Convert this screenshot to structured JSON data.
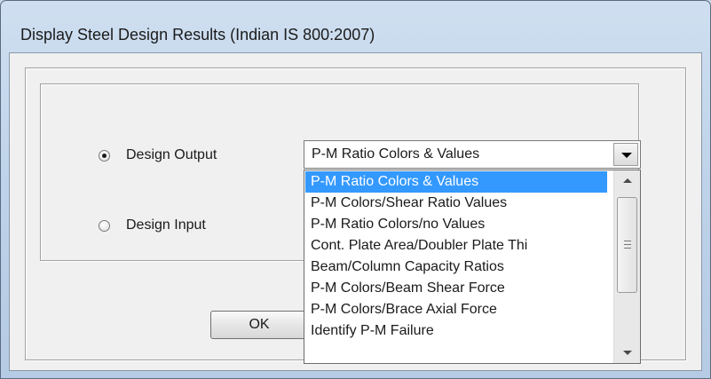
{
  "window": {
    "title": "Display Steel Design Results (Indian IS 800:2007)"
  },
  "options": {
    "design_output_label": "Design Output",
    "design_output_checked": true,
    "design_input_label": "Design Input",
    "design_input_checked": false
  },
  "combo": {
    "selected_value": "P-M Ratio Colors & Values"
  },
  "dropdown": {
    "items": [
      "P-M Ratio Colors & Values",
      "P-M Colors/Shear Ratio Values",
      "P-M Ratio Colors/no Values",
      "Cont. Plate Area/Doubler Plate Thi",
      "Beam/Column Capacity Ratios",
      "P-M Colors/Beam Shear Force",
      "P-M Colors/Brace Axial Force",
      "Identify P-M Failure"
    ],
    "highlighted_index": 0
  },
  "buttons": {
    "ok_label": "OK"
  },
  "colors": {
    "selection": "#3399ff",
    "dialog_face": "#f0f0f0",
    "title_gradient_top": "#cfdff0"
  },
  "icons": {
    "combo_arrow": "chevron-down-icon",
    "scroll_up": "scroll-up-icon",
    "scroll_down": "scroll-down-icon",
    "scroll_thumb_grip": "grip-icon"
  }
}
